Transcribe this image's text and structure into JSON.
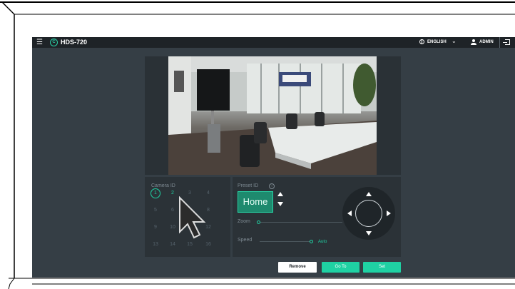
{
  "header": {
    "title": "HDS-720",
    "language": "ENGLISH",
    "user": "ADMIN"
  },
  "camera": {
    "title": "Camera ID",
    "ids": [
      "1",
      "2",
      "3",
      "4",
      "5",
      "6",
      "7",
      "8",
      "9",
      "10",
      "11",
      "12",
      "13",
      "14",
      "15",
      "16"
    ],
    "selected": "1"
  },
  "preset": {
    "title": "Preset ID",
    "value": "Home",
    "zoom_label": "Zoom",
    "speed_label": "Speed",
    "speed_mode": "Auto",
    "zoom_level": 0.0,
    "speed_level": 1.0
  },
  "buttons": {
    "remove": "Remove",
    "goto": "Go To",
    "set": "Set"
  },
  "colors": {
    "accent": "#1fd1a3",
    "topbar": "#1e2327",
    "background": "#353e45"
  },
  "icons": [
    "menu-icon",
    "logo-icon",
    "globe-icon",
    "chevron-down-icon",
    "user-icon",
    "logout-icon",
    "info-icon",
    "arrow-up-icon",
    "arrow-down-icon",
    "pan-up-icon",
    "pan-down-icon",
    "pan-left-icon",
    "pan-right-icon",
    "cursor-icon"
  ]
}
